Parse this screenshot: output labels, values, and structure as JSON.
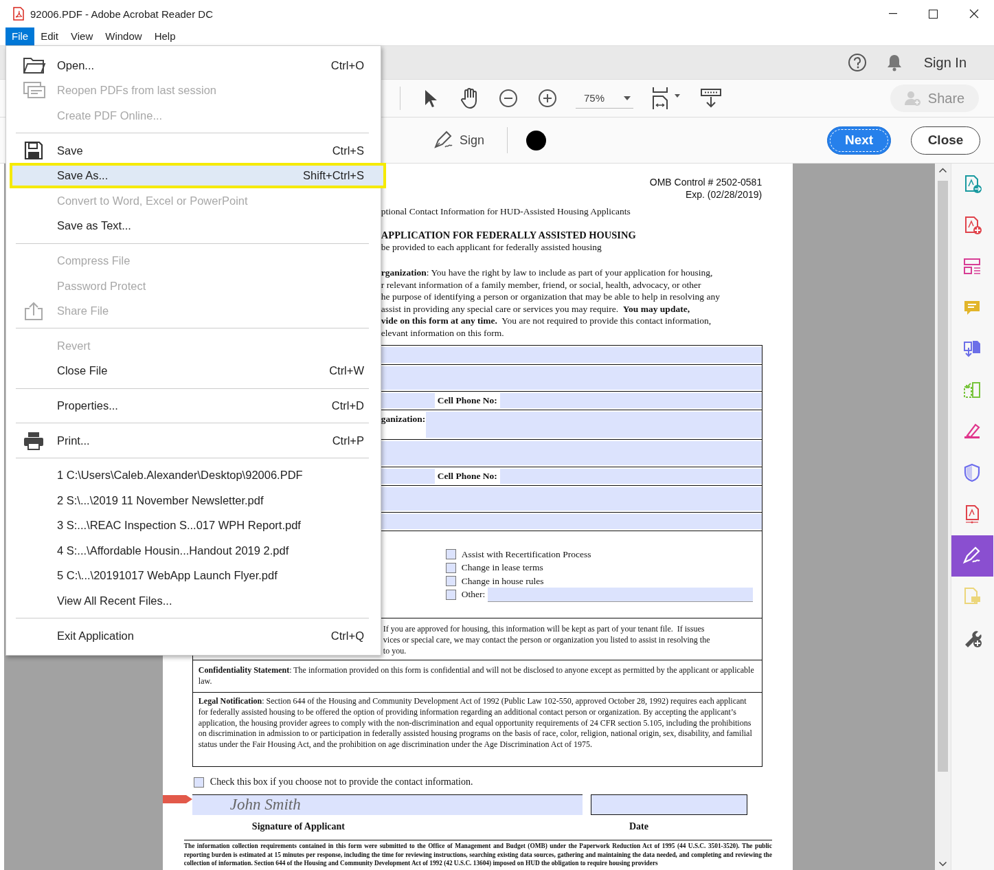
{
  "window": {
    "title": "92006.PDF - Adobe Acrobat Reader DC"
  },
  "menu_bar": [
    {
      "label": "File",
      "selected": true
    },
    {
      "label": "Edit",
      "selected": false
    },
    {
      "label": "View",
      "selected": false
    },
    {
      "label": "Window",
      "selected": false
    },
    {
      "label": "Help",
      "selected": false
    }
  ],
  "file_menu": [
    {
      "kind": "open",
      "label": "Open...",
      "shortcut": "Ctrl+O",
      "disabled": false,
      "selected": false
    },
    {
      "kind": "reopen",
      "label": "Reopen PDFs from last session",
      "disabled": true,
      "selected": false
    },
    {
      "kind": "item",
      "label": "Create PDF Online...",
      "disabled": true,
      "selected": false
    },
    {
      "kind": "separator"
    },
    {
      "kind": "save",
      "label": "Save",
      "shortcut": "Ctrl+S",
      "disabled": false,
      "selected": false
    },
    {
      "kind": "item",
      "label": "Save As...",
      "shortcut": "Shift+Ctrl+S",
      "disabled": false,
      "selected": true
    },
    {
      "kind": "item",
      "label": "Convert to Word, Excel or PowerPoint",
      "disabled": true,
      "selected": false
    },
    {
      "kind": "item",
      "label": "Save as Text...",
      "disabled": false,
      "selected": false
    },
    {
      "kind": "separator"
    },
    {
      "kind": "item",
      "label": "Compress File",
      "disabled": true,
      "selected": false
    },
    {
      "kind": "item",
      "label": "Password Protect",
      "disabled": true,
      "selected": false
    },
    {
      "kind": "share",
      "label": "Share File",
      "disabled": true,
      "selected": false
    },
    {
      "kind": "separator"
    },
    {
      "kind": "item",
      "label": "Revert",
      "disabled": true,
      "selected": false
    },
    {
      "kind": "item",
      "label": "Close File",
      "shortcut": "Ctrl+W",
      "disabled": false,
      "selected": false
    },
    {
      "kind": "separator"
    },
    {
      "kind": "item",
      "label": "Properties...",
      "shortcut": "Ctrl+D",
      "disabled": false,
      "selected": false
    },
    {
      "kind": "separator"
    },
    {
      "kind": "print",
      "label": "Print...",
      "shortcut": "Ctrl+P",
      "disabled": false,
      "selected": false
    },
    {
      "kind": "separator"
    },
    {
      "kind": "item",
      "label": "1 C:\\Users\\Caleb.Alexander\\Desktop\\92006.PDF",
      "disabled": false,
      "selected": false
    },
    {
      "kind": "item",
      "label": "2 S:\\...\\2019 11 November Newsletter.pdf",
      "disabled": false,
      "selected": false
    },
    {
      "kind": "item",
      "label": "3 S:...\\REAC Inspection S...017 WPH Report.pdf",
      "disabled": false,
      "selected": false
    },
    {
      "kind": "item",
      "label": "4 S:...\\Affordable Housin...Handout 2019 2.pdf",
      "disabled": false,
      "selected": false
    },
    {
      "kind": "item",
      "label": "5 C:\\...\\20191017 WebApp Launch Flyer.pdf",
      "disabled": false,
      "selected": false
    },
    {
      "kind": "item",
      "label": "View All Recent Files...",
      "disabled": false,
      "selected": false
    },
    {
      "kind": "separator"
    },
    {
      "kind": "item",
      "label": "Exit Application",
      "shortcut": "Ctrl+Q",
      "disabled": false,
      "selected": false
    }
  ],
  "top_bar": {
    "sign_in": "Sign In"
  },
  "toolbar": {
    "zoom": "75%",
    "share": {
      "label": "Share",
      "disabled": true
    }
  },
  "sign_bar": {
    "sign": "Sign",
    "next": "Next",
    "close": "Close"
  },
  "document": {
    "header": [
      "OMB Control # 2502-0581",
      "Exp. (02/28/2019)"
    ],
    "subtitle": "ptional Contact Information for HUD-Assisted Housing Applicants",
    "heading": "APPLICATION FOR FEDERALLY ASSISTED HOUSING",
    "subheading": "be provided to each applicant for federally assisted housing",
    "intro_lines": [
      "**rganization**: You have the right by law to include as part of your application for housing,",
      "r relevant information of a family member, friend, or social, health, advocacy, or other",
      "he purpose of identifying a person or organization that may be able to help in resolving any",
      "assist in providing any special care or services you may require.  **You may update,**",
      "**vide on this form at any time.**  You are not required to provide this contact information,",
      "elevant information on this form."
    ],
    "form_rows": [
      {
        "kind": "line"
      },
      {
        "kind": "block"
      },
      {
        "kind": "labeled",
        "label": "Cell Phone No:"
      },
      {
        "kind": "labeled-start",
        "label": "ganization:"
      },
      {
        "kind": "block"
      },
      {
        "kind": "labeled",
        "label": "Cell Phone No:"
      },
      {
        "kind": "block"
      },
      {
        "kind": "line"
      }
    ],
    "options": [
      {
        "kind": "option",
        "label": "Assist with Recertification Process",
        "checked": false
      },
      {
        "kind": "option",
        "label": "Change in lease terms",
        "checked": false
      },
      {
        "kind": "option",
        "label": "Change in house rules",
        "checked": false
      },
      {
        "kind": "other",
        "label": "Other:",
        "checked": false
      }
    ],
    "approval_lines": [
      "If you are approved for housing, this information will be kept as part of your tenant file.  If issues",
      "vices or special care, we may contact the person or organization you listed to assist in resolving the",
      "to you."
    ],
    "confidentiality": "**Confidentiality Statement**: The information provided on this form is confidential and will not be disclosed to anyone except as permitted by the applicant or applicable law.",
    "legal": "**Legal Notification**: Section 644 of the Housing and Community Development Act of 1992 (Public Law 102-550, approved October 28, 1992) requires each applicant for federally assisted housing to be offered the option of providing information regarding an additional contact person or organization. By accepting the applicant’s application, the housing provider agrees to comply with the non-discrimination and equal opportunity requirements of 24 CFR section 5.105, including the prohibitions on discrimination in admission to or participation in federally assisted housing programs on the basis of race, color, religion, national origin, sex, disability, and familial status under the Fair Housing Act, and the prohibition on age discrimination under the Age Discrimination Act of 1975.",
    "opt_out": {
      "label": "Check this box if you choose not to provide the contact information.",
      "checked": false
    },
    "signature": {
      "value": "John Smith",
      "label": "Signature of Applicant"
    },
    "date": {
      "label": "Date"
    },
    "footer": "The information collection requirements contained in this form were submitted to the Office of Management and Budget (OMB) under the Paperwork Reduction Act of 1995 (44 U.S.C. 3501-3520).  The public reporting burden is estimated at 15 minutes per response, including the time for reviewing instructions, searching existing data sources, gathering and maintaining the data needed, and completing and reviewing the collection of information.  Section 644 of the Housing and Community Development Act of 1992 (42 U.S.C. 13604) imposed on HUD the obligation to require housing providers"
  },
  "tools_panel": [
    {
      "kind": "export",
      "color": "#1a9aa0",
      "selected": false
    },
    {
      "kind": "create",
      "color": "#e0434b",
      "selected": false
    },
    {
      "kind": "organize",
      "color": "#d73d95",
      "selected": false
    },
    {
      "kind": "comment",
      "color": "#e2b52a",
      "selected": false
    },
    {
      "kind": "combine",
      "color": "#6c6fe8",
      "selected": false
    },
    {
      "kind": "compress",
      "color": "#78c43c",
      "selected": false
    },
    {
      "kind": "edit",
      "color": "#e0368c",
      "selected": false
    },
    {
      "kind": "protect",
      "color": "#6d6ded",
      "selected": false
    },
    {
      "kind": "fill",
      "color": "#e0434b",
      "selected": false
    },
    {
      "kind": "sign",
      "color": "#8a4fd0",
      "selected": true
    },
    {
      "kind": "send",
      "color": "#ecd67a",
      "selected": false
    },
    {
      "kind": "more",
      "color": "#555555",
      "selected": false
    }
  ]
}
